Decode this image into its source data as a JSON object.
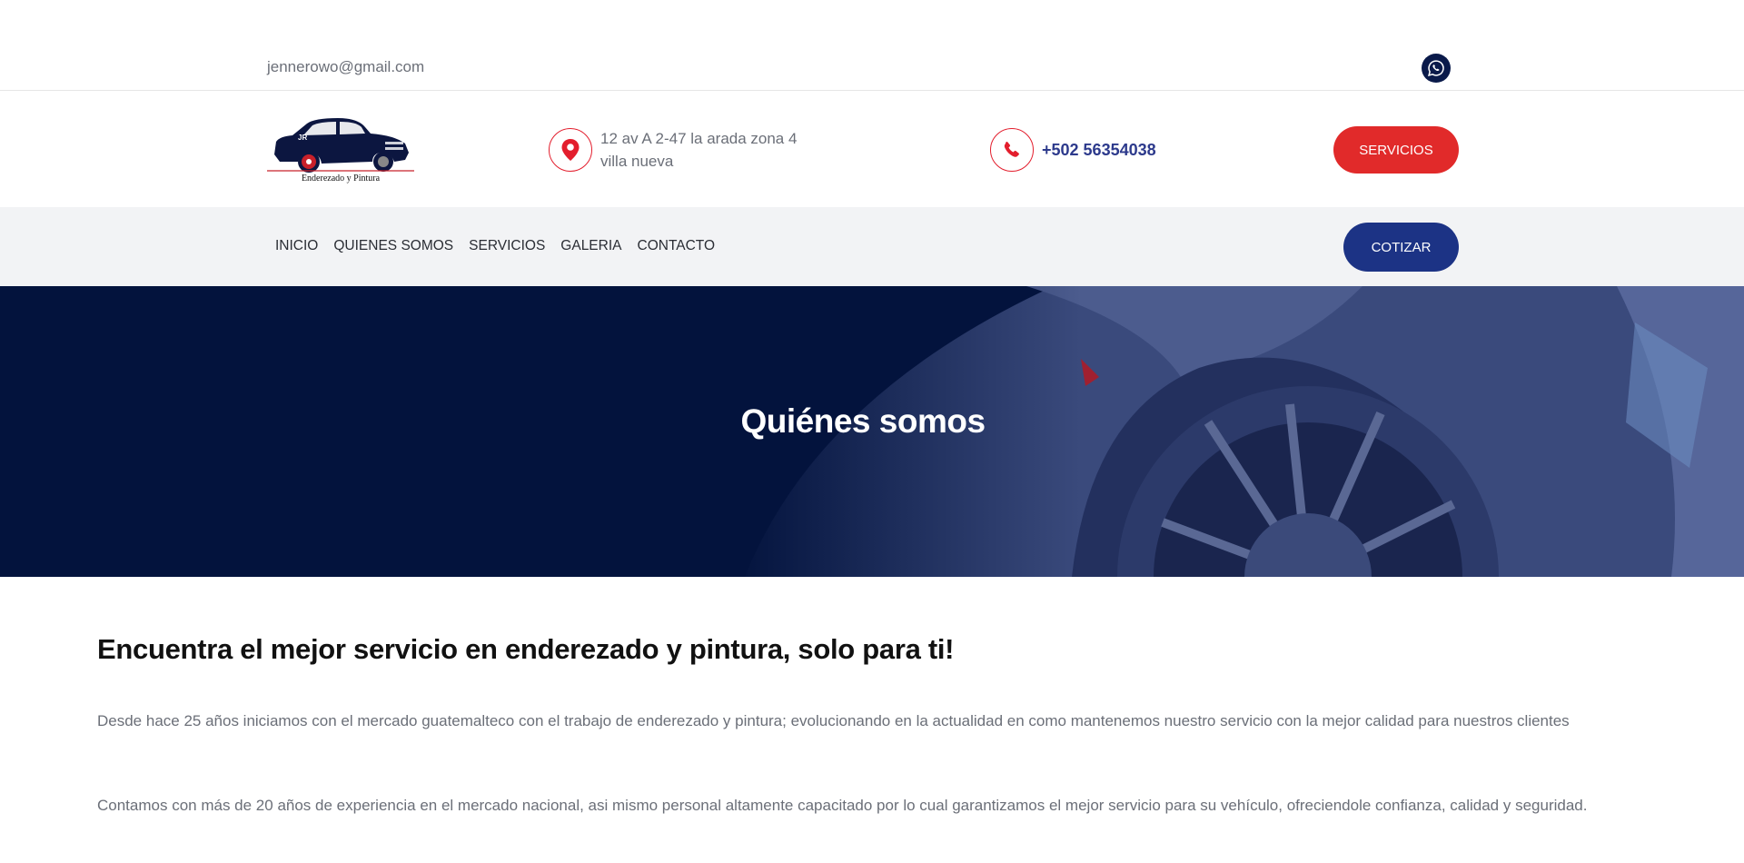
{
  "topbar": {
    "email": "jennerowo@gmail.com",
    "whatsapp_icon": "whatsapp-icon"
  },
  "header": {
    "logo_text": "Enderezado y Pintura",
    "logo_badge": "JR",
    "address_line1": "12 av A 2-47 la arada zona 4",
    "address_line2": "villa nueva",
    "phone": "+502 56354038",
    "services_button": "SERVICIOS"
  },
  "nav": {
    "items": [
      "INICIO",
      "QUIENES SOMOS",
      "SERVICIOS",
      "GALERIA",
      "CONTACTO"
    ],
    "quote_button": "COTIZAR"
  },
  "hero": {
    "title": "Quiénes somos"
  },
  "content": {
    "heading": "Encuentra el mejor servicio en enderezado y pintura, solo para ti!",
    "paragraph1": "Desde hace 25 años iniciamos con el mercado guatemalteco con el trabajo de enderezado y pintura; evolucionando en la actualidad en como mantenemos nuestro servicio con la mejor calidad para nuestros clientes",
    "paragraph2": "Contamos con más de 20 años de experiencia en el mercado nacional, asi mismo personal altamente capacitado por lo cual garantizamos el mejor servicio para su vehículo, ofreciendole confianza, calidad y seguridad."
  },
  "colors": {
    "accent_red": "#e12a2a",
    "brand_blue": "#1c3385",
    "hero_navy": "#03133d"
  }
}
